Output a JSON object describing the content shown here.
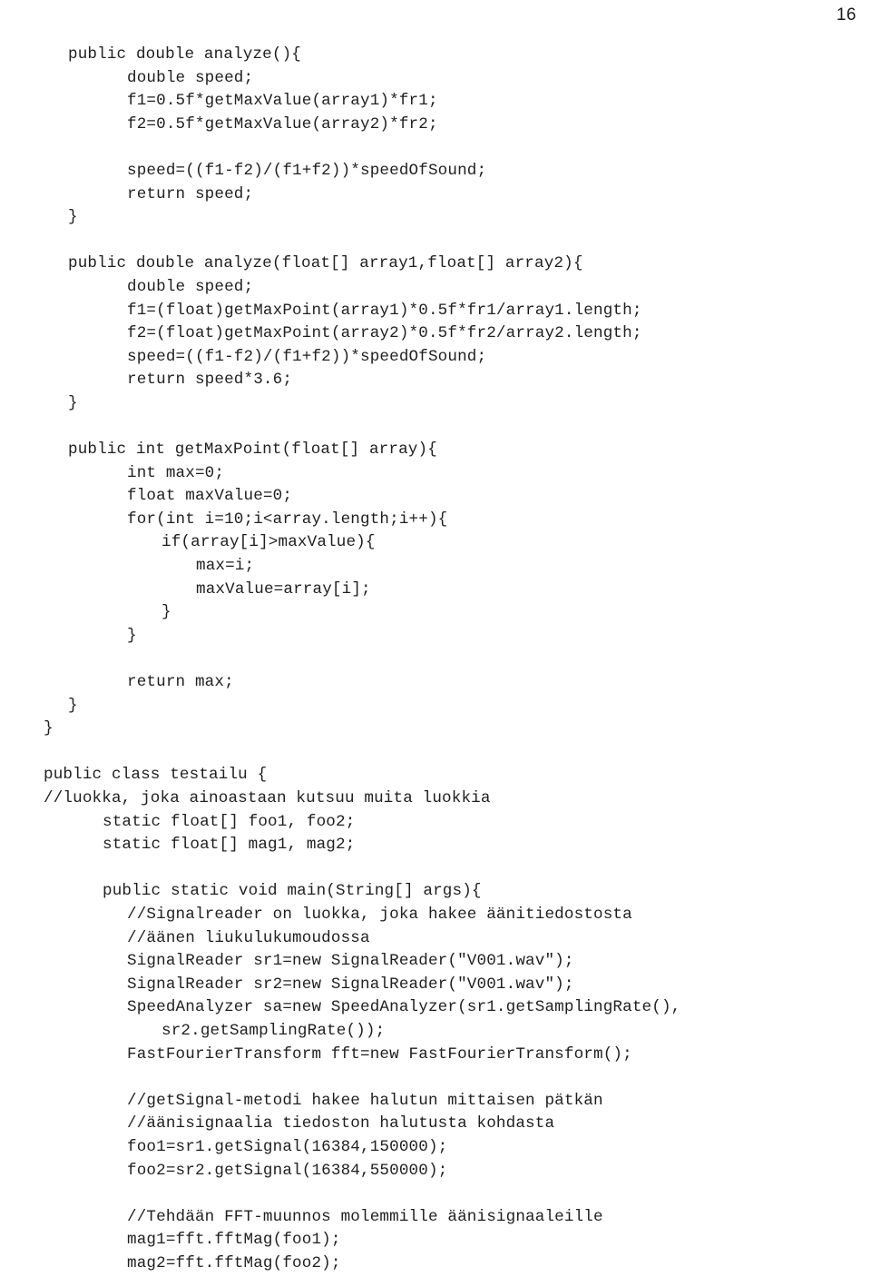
{
  "page": {
    "number": "16",
    "kind": "document-page",
    "text_color": "#1f1f1f",
    "background_color": "#ffffff"
  },
  "code": {
    "language": "java",
    "lines": [
      {
        "indent": 2,
        "text": "public double analyze(){"
      },
      {
        "indent": 4,
        "text": "double speed;"
      },
      {
        "indent": 4,
        "text": "f1=0.5f*getMaxValue(array1)*fr1;"
      },
      {
        "indent": 4,
        "text": "f2=0.5f*getMaxValue(array2)*fr2;"
      },
      {
        "indent": 0,
        "text": ""
      },
      {
        "indent": 4,
        "text": "speed=((f1-f2)/(f1+f2))*speedOfSound;"
      },
      {
        "indent": 4,
        "text": "return speed;"
      },
      {
        "indent": 2,
        "text": "}"
      },
      {
        "indent": 0,
        "text": ""
      },
      {
        "indent": 2,
        "text": "public double analyze(float[] array1,float[] array2){"
      },
      {
        "indent": 4,
        "text": "double speed;"
      },
      {
        "indent": 4,
        "text": "f1=(float)getMaxPoint(array1)*0.5f*fr1/array1.length;"
      },
      {
        "indent": 4,
        "text": "f2=(float)getMaxPoint(array2)*0.5f*fr2/array2.length;"
      },
      {
        "indent": 4,
        "text": "speed=((f1-f2)/(f1+f2))*speedOfSound;"
      },
      {
        "indent": 4,
        "text": "return speed*3.6;"
      },
      {
        "indent": 2,
        "text": "}"
      },
      {
        "indent": 0,
        "text": ""
      },
      {
        "indent": 2,
        "text": "public int getMaxPoint(float[] array){"
      },
      {
        "indent": 4,
        "text": "int max=0;"
      },
      {
        "indent": 4,
        "text": "float maxValue=0;"
      },
      {
        "indent": 4,
        "text": "for(int i=10;i<array.length;i++){"
      },
      {
        "indent": 5,
        "text": "if(array[i]>maxValue){"
      },
      {
        "indent": 6,
        "text": "max=i;"
      },
      {
        "indent": 6,
        "text": "maxValue=array[i];"
      },
      {
        "indent": 5,
        "text": "}"
      },
      {
        "indent": 4,
        "text": "}"
      },
      {
        "indent": 0,
        "text": ""
      },
      {
        "indent": 4,
        "text": "return max;"
      },
      {
        "indent": 2,
        "text": "}"
      },
      {
        "indent": 1,
        "text": "}"
      },
      {
        "indent": 0,
        "text": ""
      },
      {
        "indent": 1,
        "text": "public class testailu {"
      },
      {
        "indent": 1,
        "text": "//luokka, joka ainoastaan kutsuu muita luokkia"
      },
      {
        "indent": 3,
        "text": "static float[] foo1, foo2;"
      },
      {
        "indent": 3,
        "text": "static float[] mag1, mag2;"
      },
      {
        "indent": 0,
        "text": ""
      },
      {
        "indent": 3,
        "text": "public static void main(String[] args){"
      },
      {
        "indent": 4,
        "text": "//Signalreader on luokka, joka hakee äänitiedostosta"
      },
      {
        "indent": 4,
        "text": "//äänen liukulukumoudossa"
      },
      {
        "indent": 4,
        "text": "SignalReader sr1=new SignalReader(\"V001.wav\");"
      },
      {
        "indent": 4,
        "text": "SignalReader sr2=new SignalReader(\"V001.wav\");"
      },
      {
        "indent": 4,
        "text": "SpeedAnalyzer sa=new SpeedAnalyzer(sr1.getSamplingRate(),"
      },
      {
        "indent": 5,
        "text": "sr2.getSamplingRate());"
      },
      {
        "indent": 4,
        "text": "FastFourierTransform fft=new FastFourierTransform();"
      },
      {
        "indent": 0,
        "text": ""
      },
      {
        "indent": 4,
        "text": "//getSignal-metodi hakee halutun mittaisen pätkän"
      },
      {
        "indent": 4,
        "text": "//äänisignaalia tiedoston halutusta kohdasta"
      },
      {
        "indent": 4,
        "text": "foo1=sr1.getSignal(16384,150000);"
      },
      {
        "indent": 4,
        "text": "foo2=sr2.getSignal(16384,550000);"
      },
      {
        "indent": 0,
        "text": ""
      },
      {
        "indent": 4,
        "text": "//Tehdään FFT-muunnos molemmille äänisignaaleille"
      },
      {
        "indent": 4,
        "text": "mag1=fft.fftMag(foo1);"
      },
      {
        "indent": 4,
        "text": "mag2=fft.fftMag(foo2);"
      }
    ]
  }
}
